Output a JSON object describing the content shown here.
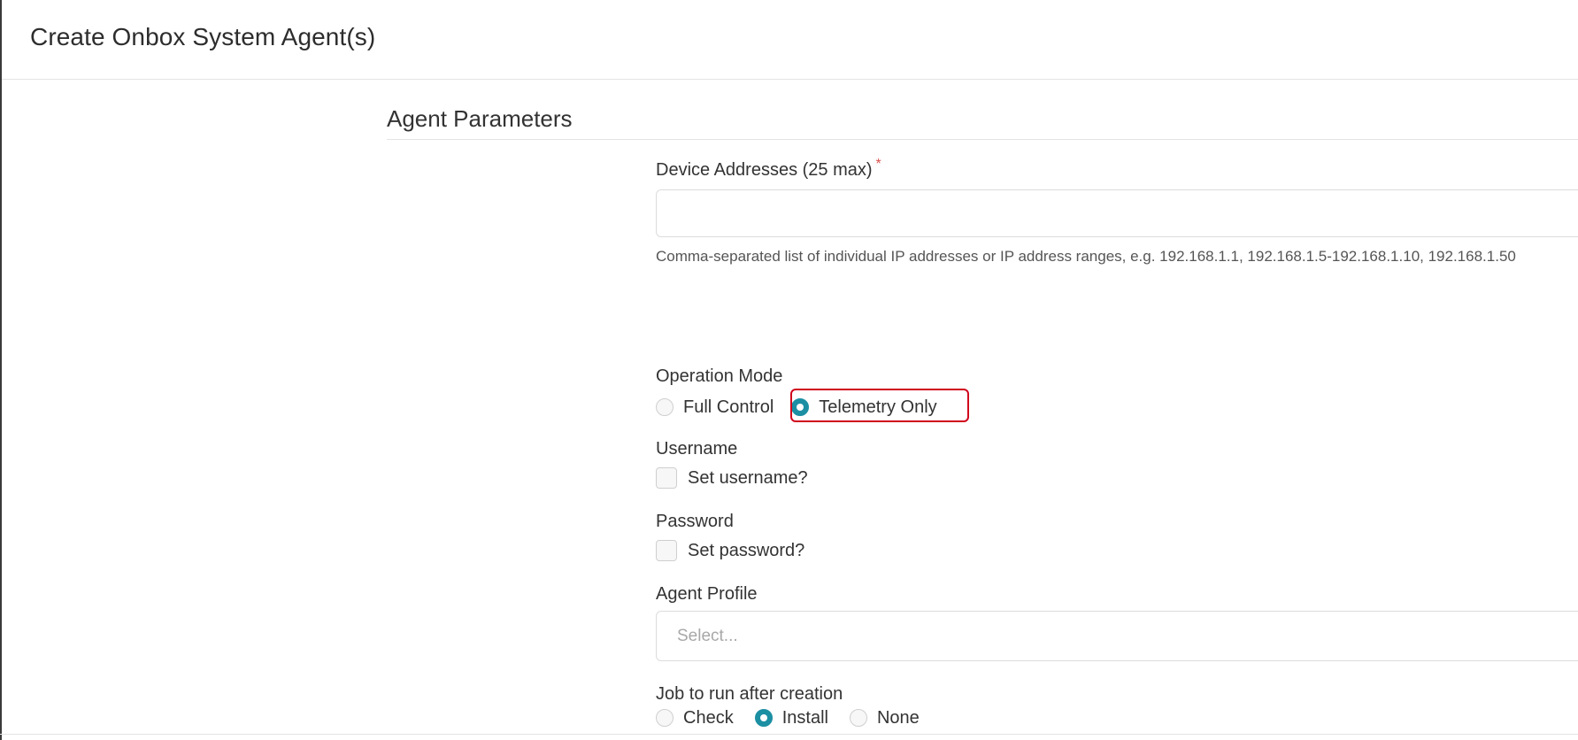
{
  "header": {
    "title": "Create Onbox System Agent(s)"
  },
  "section": {
    "title": "Agent Parameters"
  },
  "device_addresses": {
    "label": "Device Addresses (25 max)",
    "required_mark": "*",
    "value": "",
    "help": "Comma-separated list of individual IP addresses or IP address ranges, e.g. 192.168.1.1, 192.168.1.5-192.168.1.10, 192.168.1.50"
  },
  "operation_mode": {
    "label": "Operation Mode",
    "options": [
      {
        "label": "Full Control",
        "selected": false
      },
      {
        "label": "Telemetry Only",
        "selected": true
      }
    ]
  },
  "username": {
    "label": "Username",
    "checkbox_label": "Set username?",
    "checked": false
  },
  "password": {
    "label": "Password",
    "checkbox_label": "Set password?",
    "checked": false
  },
  "agent_profile": {
    "label": "Agent Profile",
    "placeholder": "Select..."
  },
  "job": {
    "label": "Job to run after creation",
    "options": [
      {
        "label": "Check",
        "selected": false
      },
      {
        "label": "Install",
        "selected": true
      },
      {
        "label": "None",
        "selected": false
      }
    ]
  },
  "colors": {
    "accent": "#1c8fa3",
    "highlight": "#d0021b",
    "required": "#d9534f"
  }
}
